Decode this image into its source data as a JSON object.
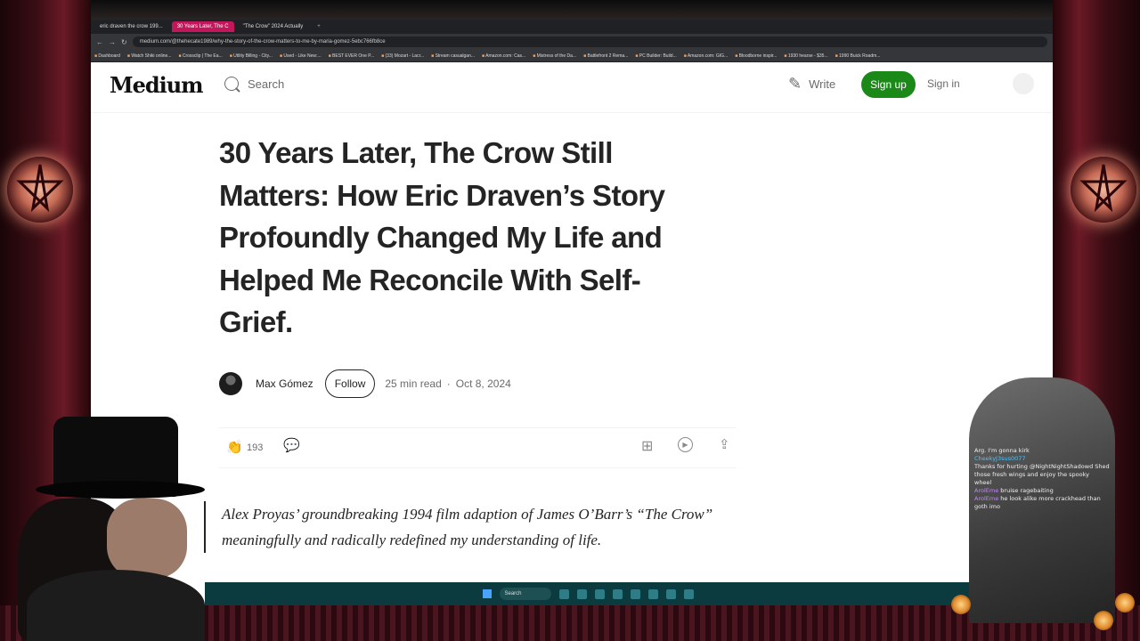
{
  "browser": {
    "tabs": [
      {
        "label": "eric draven the crow 199..."
      },
      {
        "label": "30 Years Later, The C",
        "active": true
      },
      {
        "label": "\"The Crow\" 2024 Actually"
      }
    ],
    "new_tab": "+",
    "url": "medium.com/@thehecate1989/why-the-story-of-the-crow-matters-to-me-by-maria-gomez-5ebc766fb8ce",
    "bookmarks": [
      "Dashboard",
      "Watch Shiki online...",
      "Crossclip | The Ea...",
      "Utility Billing - City...",
      "Used - Like New:...",
      "BEST EVER One P...",
      "(33) Mozart - Lacr...",
      "Stream casualgan...",
      "Amazon.com: Cas...",
      "Mistress of the Da...",
      "Battlefront 2 Rema...",
      "PC Builder: Build...",
      "Amazon.com: GIG...",
      "Bloodborne inspir...",
      "1930 hearse - $35...",
      "1990 Buick Roadm..."
    ]
  },
  "header": {
    "logo": "Medium",
    "search_label": "Search",
    "write_label": "Write",
    "signup_label": "Sign up",
    "signin_label": "Sign in"
  },
  "article": {
    "title": "30 Years Later, The Crow Still Matters: How Eric Draven’s Story Profoundly Changed My Life and Helped Me Reconcile With Self-Grief.",
    "author": "Max Gómez",
    "follow_label": "Follow",
    "read_time": "25 min read",
    "separator": "·",
    "date": "Oct 8, 2024",
    "claps": "193",
    "quote": "Alex Proyas’ groundbreaking 1994 film adaption of James O’Barr’s “The Crow” meaningfully and radically redefined my understanding of life."
  },
  "taskbar": {
    "search_label": "Search"
  },
  "chat": [
    {
      "user": "",
      "text": "Arg. I'm gonna kirk"
    },
    {
      "user": "CheekyJ3sus0077",
      "text": ""
    },
    {
      "user": "",
      "text": "Thanks for hurting @NightNightShadowd Shed those fresh wings and enjoy the spooky"
    },
    {
      "user": "",
      "text": "wheel"
    },
    {
      "user": "ArolEme",
      "text": "bruise ragebaiting"
    },
    {
      "user": "ArolEme",
      "text": "he look alike more crackhead than goth imo"
    }
  ],
  "colors": {
    "accent_green": "#1a8917",
    "active_tab": "#c2185b",
    "text_primary": "#242424",
    "text_muted": "#6b6b6b"
  }
}
